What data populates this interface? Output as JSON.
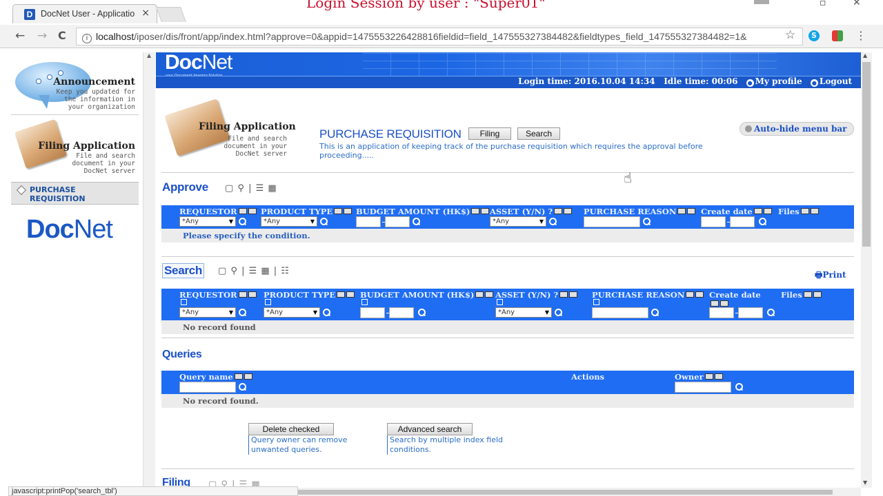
{
  "browser": {
    "tab_title": "DocNet User - Applicatio",
    "tab_favicon_letter": "D",
    "tab_close": "×",
    "session_title": "Login Session by user : \"Super01\"",
    "url_host": "localhost",
    "url_rest": "/iposer/dis/front/app/index.html?approve=0&appid=1475553226428816fieldid=field_147555327384482&fieldtypes_field_147555327384482=1&",
    "status_text": "javascript:printPop('search_tbl')",
    "back": "←",
    "forward": "→",
    "reload": "C",
    "star": "☆",
    "menu": "⋮"
  },
  "sidebar": {
    "announcement_title": "Announcement",
    "announcement_desc": "Keep you updated for the information in your organization",
    "filing_title": "Filing Application",
    "filing_desc": "File and search document in your DocNet server",
    "active_item": "PURCHASE REQUISITION",
    "logo_bold": "Doc",
    "logo_light": "Net"
  },
  "banner": {
    "logo_bold": "Doc",
    "logo_light": "Net",
    "tagline": "your Document Imaging Solution",
    "login_time": "Login time: 2016.10.04 14:34",
    "idle_time": "Idle time: 00:06",
    "my_profile": "My profile",
    "logout": "Logout"
  },
  "app": {
    "title": "Filing Application",
    "desc": "File and search document in your DocNet server",
    "page_heading": "PURCHASE REQUISITION",
    "filing_btn": "Filing",
    "search_btn": "Search",
    "description": "This is an application of keeping track of the purchase requisition which requires the approval before proceeding.....",
    "autohide": "Auto-hide menu bar"
  },
  "approve": {
    "title": "Approve",
    "columns": [
      "REQUESTOR",
      "PRODUCT TYPE",
      "BUDGET AMOUNT (HK$)",
      "ASSET (Y/N) ?",
      "PURCHASE REASON",
      "Create date",
      "Files"
    ],
    "any": "*Any",
    "message": "Please specify the condition."
  },
  "search": {
    "title": "Search",
    "print": "Print",
    "columns": [
      "REQUESTOR",
      "PRODUCT TYPE",
      "BUDGET AMOUNT (HK$)",
      "ASSET (Y/N) ?",
      "PURCHASE REASON",
      "Create date",
      "Files"
    ],
    "any": "*Any",
    "message": "No record found"
  },
  "queries": {
    "title": "Queries",
    "columns": [
      "Query name",
      "Actions",
      "Owner"
    ],
    "message": "No record found.",
    "delete_btn": "Delete checked",
    "delete_help": "Query owner can remove unwanted queries.",
    "advanced_btn": "Advanced search",
    "advanced_help": "Search by multiple index field conditions."
  },
  "filing": {
    "title": "Filing"
  },
  "colors": {
    "brand_blue": "#1f6df2",
    "link_blue": "#1a4fc9",
    "session_red": "#c8102e"
  }
}
